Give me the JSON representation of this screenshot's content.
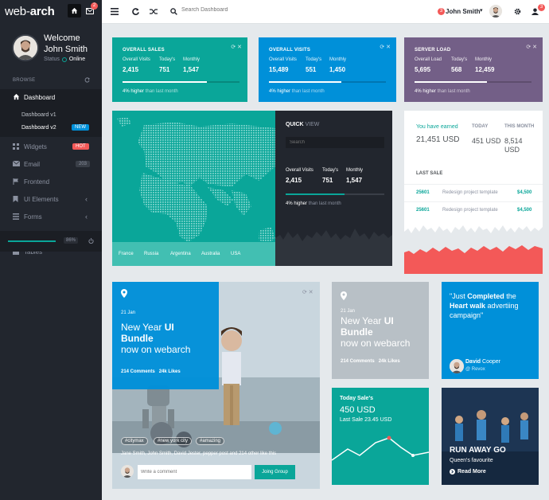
{
  "brand": {
    "logo_light": "web-",
    "logo_bold": "arch",
    "mail_badge": "2"
  },
  "profile": {
    "welcome": "Welcome",
    "name": "John Smith",
    "status_label": "Status",
    "status_value": "Online"
  },
  "sidebar": {
    "browse": "BROWSE",
    "dashboard": "Dashboard",
    "sub": [
      {
        "label": "Dashboard v1"
      },
      {
        "label": "Dashboard v2",
        "badge": "NEW"
      }
    ],
    "items": [
      {
        "label": "Widgets",
        "badge": "HOT"
      },
      {
        "label": "Email",
        "badge": "203"
      },
      {
        "label": "Frontend"
      },
      {
        "label": "UI Elements"
      },
      {
        "label": "Forms"
      },
      {
        "label": "Tables"
      }
    ],
    "progress_pct": "86%",
    "progress_fraction": 0.86
  },
  "header": {
    "search_placeholder": "Search Dashboard",
    "user_badge": "3",
    "user_name": "John Smith",
    "notif_badge": "3"
  },
  "tiles": [
    {
      "title": "OVERALL SALES",
      "color": "#0aa699",
      "stats": [
        {
          "k": "Overall Visits",
          "v": "2,415"
        },
        {
          "k": "Today's",
          "v": "751"
        },
        {
          "k": "Monthly",
          "v": "1,547"
        }
      ],
      "progress": 0.72,
      "foot_hi": "4% higher",
      "foot_rest": "than last month"
    },
    {
      "title": "OVERALL VISITS",
      "color": "#0090d9",
      "stats": [
        {
          "k": "Overall Visits",
          "v": "15,489"
        },
        {
          "k": "Today's",
          "v": "551"
        },
        {
          "k": "Monthly",
          "v": "1,450"
        }
      ],
      "progress": 0.62,
      "foot_hi": "4% higher",
      "foot_rest": "than last month"
    },
    {
      "title": "SERVER LOAD",
      "color": "#735f87",
      "stats": [
        {
          "k": "Overall Load",
          "v": "5,695"
        },
        {
          "k": "Today's",
          "v": "568"
        },
        {
          "k": "Monthly",
          "v": "12,459"
        }
      ],
      "progress": 0.62,
      "foot_hi": "4% higher",
      "foot_rest": "than last month"
    }
  ],
  "map": {
    "countries": [
      "France",
      "Russia",
      "Argentina",
      "Australia",
      "USA"
    ]
  },
  "quick": {
    "title_bold": "QUICK",
    "title_light": " VIEW",
    "search_placeholder": "Search",
    "stats": [
      {
        "k": "Overall Visits",
        "v": "2,415"
      },
      {
        "k": "Today's",
        "v": "751"
      },
      {
        "k": "Monthly",
        "v": "1,547"
      }
    ],
    "progress": 0.6,
    "foot_hi": "4% higher",
    "foot_rest": "than last month"
  },
  "sales": {
    "earned_label": "You have earned",
    "earned_value": "21,451 USD",
    "today_label": "TODAY",
    "today_value": "451 USD",
    "month_label": "THIS MONTH",
    "month_value": "8,514 USD",
    "last_sale": "LAST SALE",
    "rows": [
      {
        "id": "25601",
        "desc": "Redesign project template",
        "amount": "$4,500"
      },
      {
        "id": "25601",
        "desc": "Redesign project template",
        "amount": "$4,500"
      }
    ]
  },
  "blog": {
    "date": "21 Jan",
    "title_l1a": "New Year ",
    "title_l1b": "UI",
    "title_l2": "Bundle",
    "title_l3": "now on webarch",
    "comments": "214 Comments",
    "likes": "24k Likes",
    "tags": [
      "#citymax",
      "#new york city",
      "#amazing"
    ],
    "people": "Jane Smith, John Smith, David Jester, pepper post and 214 other like this",
    "comment_placeholder": "Write a comment",
    "join": "Joing Group"
  },
  "grey_card": {
    "date": "21 Jan",
    "title_l1a": "New Year ",
    "title_l1b": "UI",
    "title_l2": "Bundle",
    "title_l3": "now on webarch",
    "comments": "214 Comments",
    "likes": "24k Likes"
  },
  "quote": {
    "q1": "\"Just ",
    "q2": "Completed",
    "q3": " the",
    "q4": "Heart walk",
    "q5": " advertiing",
    "q6": "campaign\"",
    "author_first": "David",
    "author_last": " Cooper",
    "via": "Revox"
  },
  "today_sales": {
    "title": "Today Sale's",
    "value": "450 USD",
    "last": "Last Sale 23.45 USD"
  },
  "runaway": {
    "title": "RUN AWAY GO",
    "subtitle": "Queen's favourite",
    "more": "Read More"
  }
}
